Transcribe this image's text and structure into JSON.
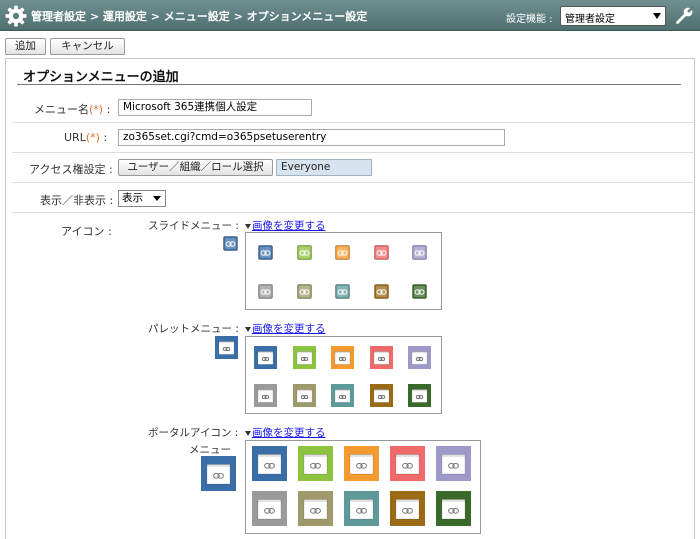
{
  "header": {
    "breadcrumb": "管理者設定 > 運用設定 > メニュー設定 > オプションメニュー設定",
    "function_label": "設定機能 :",
    "function_select_value": "管理者設定"
  },
  "toolbar": {
    "add_label": "追加",
    "cancel_label": "キャンセル"
  },
  "form": {
    "title": "オプションメニューの追加",
    "menu_name": {
      "label": "メニュー名",
      "required": "(*)",
      "colon": ":",
      "value": "Microsoft 365連携個人設定"
    },
    "url": {
      "label": "URL",
      "required": "(*)",
      "colon": ":",
      "value": "zo365set.cgi?cmd=o365psetuserentry"
    },
    "access": {
      "label": "アクセス権設定 :",
      "button": "ユーザー／組織／ロール選択",
      "value": "Everyone"
    },
    "visibility": {
      "label": "表示／非表示 :",
      "value": "表示"
    },
    "icon": {
      "label": "アイコン :",
      "change_label": "画像を変更する",
      "slide": {
        "label": "スライドメニュー :"
      },
      "palette": {
        "label": "パレットメニュー :"
      },
      "portal": {
        "label": "ポータルアイコン :",
        "sublabel": "メニュー"
      }
    }
  },
  "icons": {
    "colors": [
      "#3a6ea8",
      "#8cc43f",
      "#f59a2f",
      "#f06a6a",
      "#9d9ac9",
      "#9a9a9a",
      "#9e9a6a",
      "#5f9a9a",
      "#9a6a14",
      "#3a6a2a"
    ],
    "selected_color": "#3a6ea8",
    "glyph": "link-chain-icon"
  }
}
